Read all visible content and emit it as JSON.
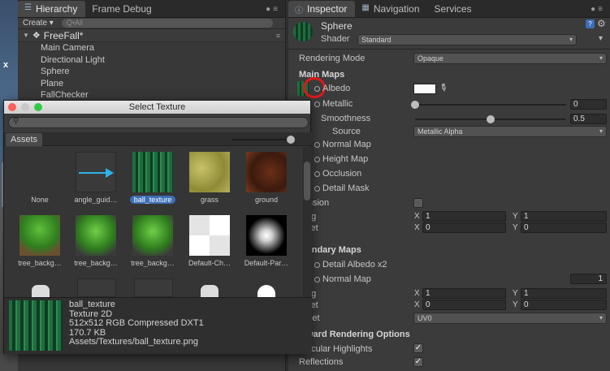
{
  "hierarchy": {
    "tabs": [
      "Hierarchy",
      "Frame Debug"
    ],
    "create_label": "Create",
    "search_placeholder": "Q•All",
    "scene_name": "FreeFall*",
    "items": [
      "Main Camera",
      "Directional Light",
      "Sphere",
      "Plane",
      "FallChecker"
    ]
  },
  "scene_view": {
    "marker": "x"
  },
  "inspector": {
    "tabs": [
      "Inspector",
      "Navigation",
      "Services"
    ],
    "object_name": "Sphere",
    "shader_label": "Shader",
    "shader_value": "Standard",
    "rendering_mode_label": "Rendering Mode",
    "rendering_mode_value": "Opaque",
    "main_maps_header": "Main Maps",
    "albedo_label": "Albedo",
    "metallic_label": "Metallic",
    "metallic_value": "0",
    "smoothness_label": "Smoothness",
    "smoothness_value": "0.5",
    "source_label": "Source",
    "source_value": "Metallic Alpha",
    "normal_map_label": "Normal Map",
    "height_map_label": "Height Map",
    "occlusion_label": "Occlusion",
    "detail_mask_label": "Detail Mask",
    "emission_label": "ission",
    "tiling_label": "ng",
    "offset_label": "set",
    "tiling_x": "1",
    "tiling_y": "1",
    "offset_x": "0",
    "offset_y": "0",
    "secondary_header": "ondary Maps",
    "detail_albedo_label": "Detail Albedo x2",
    "normal_map2_label": "Normal Map",
    "normal_map2_value": "1",
    "tiling2_label": "ng",
    "offset2_label": "set",
    "tiling2_x": "1",
    "tiling2_y": "1",
    "offset2_x": "0",
    "offset2_y": "0",
    "uvset_label": "Set",
    "uvset_value": "UV0",
    "forward_header": "ward Rendering Options",
    "specular_label": "ecular Highlights",
    "reflections_label": "Reflections",
    "axis_x": "X",
    "axis_y": "Y",
    "smoothness_fraction": 0.5,
    "metallic_fraction": 0.0
  },
  "dialog": {
    "title": "Select Texture",
    "tab": "Assets",
    "assets": [
      {
        "name": "None"
      },
      {
        "name": "angle_guid…"
      },
      {
        "name": "ball_texture",
        "selected": true
      },
      {
        "name": "grass"
      },
      {
        "name": "ground"
      },
      {
        "name": "tree_backg…"
      },
      {
        "name": "tree_backg…"
      },
      {
        "name": "tree_backg…"
      },
      {
        "name": "Default-Ch…"
      },
      {
        "name": "Default-Par…"
      }
    ],
    "preview": {
      "name": "ball_texture",
      "type": "Texture 2D",
      "format": "512x512  RGB Compressed DXT1",
      "size": "170.7 KB",
      "path": "Assets/Textures/ball_texture.png"
    }
  },
  "colors": {
    "selection": "#3d6fb6",
    "highlight_ring": "#e01818"
  }
}
